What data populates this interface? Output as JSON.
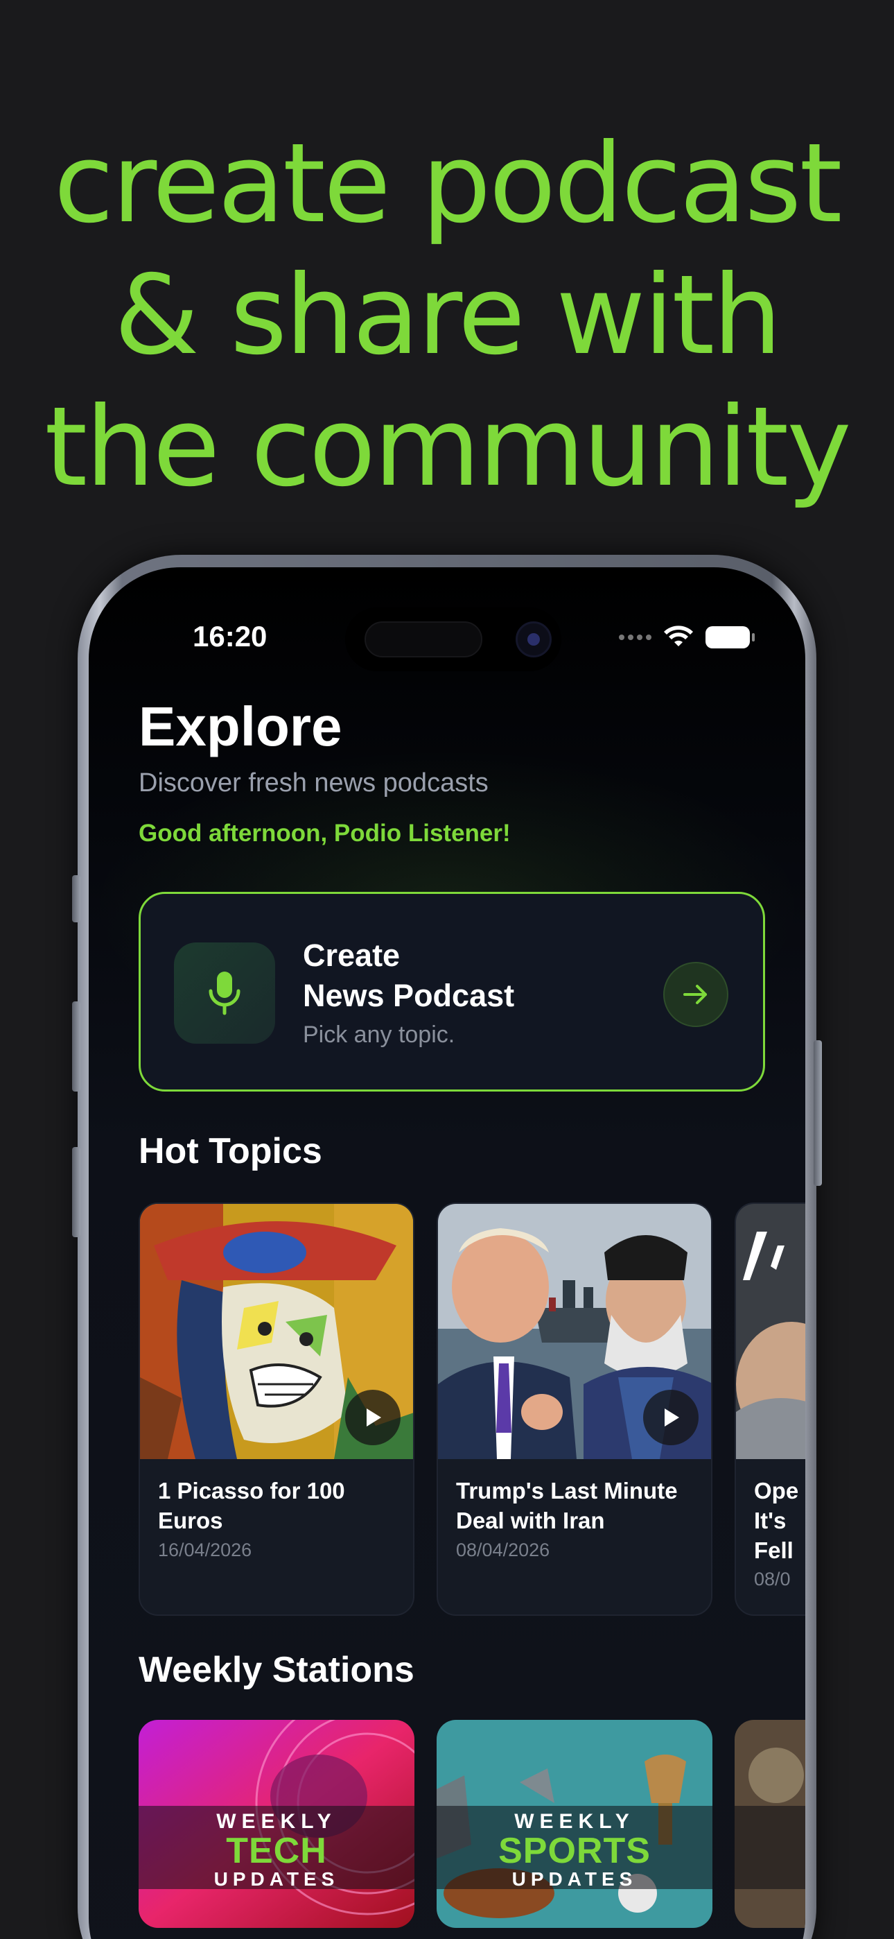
{
  "headline": {
    "line1": "create podcast",
    "line2": "& share with",
    "line3": "the community"
  },
  "status_bar": {
    "time": "16:20"
  },
  "header": {
    "title": "Explore",
    "subtitle": "Discover fresh news podcasts",
    "greeting": "Good afternoon, Podio Listener!"
  },
  "create_card": {
    "title_line1": "Create",
    "title_line2": "News Podcast",
    "subtitle": "Pick any topic.",
    "icon": "microphone-icon",
    "action_icon": "arrow-right-icon"
  },
  "hot_topics": {
    "title": "Hot Topics",
    "items": [
      {
        "title": "1 Picasso for 100 Euros",
        "date": "16/04/2026"
      },
      {
        "title": "Trump's Last Minute Deal with Iran",
        "date": "08/04/2026"
      },
      {
        "title_line1": "Ope",
        "title_line2": "It's",
        "title_line3": "Fell",
        "date": "08/0"
      }
    ]
  },
  "weekly_stations": {
    "title": "Weekly Stations",
    "items": [
      {
        "top": "WEEKLY",
        "main": "TECH",
        "bottom": "UPDATES"
      },
      {
        "top": "WEEKLY",
        "main": "SPORTS",
        "bottom": "UPDATES"
      }
    ]
  },
  "colors": {
    "accent": "#7ed93a",
    "background": "#1a1a1c",
    "card": "#151a24"
  }
}
